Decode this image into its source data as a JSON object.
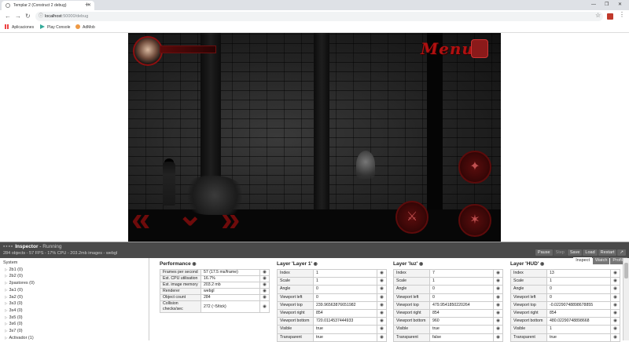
{
  "browser": {
    "tab_title": "Templar 2 (Construct 2 debug)",
    "url_host": "localhost",
    "url_path": ":50000/debug",
    "bookmarks": [
      "Aplicaciones",
      "Play Console",
      "AdMob"
    ]
  },
  "game": {
    "menu_label": "Menu"
  },
  "inspector": {
    "title": "Inspector",
    "status": "Running",
    "stats": "284 objects - 57 FPS - 17% CPU - 203.2mb images - webgl",
    "buttons": [
      "Pause",
      "Step",
      "Save",
      "Load",
      "Restart"
    ],
    "tabs": [
      "Inspect",
      "Watch",
      "Profile"
    ],
    "tree": [
      "System",
      "2b1 (0)",
      "2b2 (0)",
      "2pastores (0)",
      "3a1 (0)",
      "3a2 (0)",
      "3s3 (0)",
      "3s4 (0)",
      "3s5 (0)",
      "3s6 (0)",
      "3s7 (0)",
      "Activador (1)"
    ],
    "performance": {
      "title": "Performance",
      "rows": [
        [
          "Frames per second",
          "57 (17.5 ms/frame)"
        ],
        [
          "Est. CPU utilisation",
          "16.7%"
        ],
        [
          "Est. image memory",
          "203.2 mb"
        ],
        [
          "Renderer",
          "webgl"
        ],
        [
          "Object count",
          "284"
        ],
        [
          "Collision checks/sec",
          "272 (~5/tick)"
        ]
      ]
    },
    "layers": [
      {
        "title": "Layer 'Layer 1'",
        "rows": [
          [
            "Index",
            "1"
          ],
          [
            "Scale",
            "1"
          ],
          [
            "Angle",
            "0"
          ],
          [
            "Viewport left",
            "0"
          ],
          [
            "Viewport top",
            "239.96563876651982"
          ],
          [
            "Viewport right",
            "854"
          ],
          [
            "Viewport bottom",
            "720.0114537444933"
          ],
          [
            "Visible",
            "true"
          ],
          [
            "Transparent",
            "true"
          ]
        ]
      },
      {
        "title": "Layer 'luz'",
        "rows": [
          [
            "Index",
            "7"
          ],
          [
            "Scale",
            "1"
          ],
          [
            "Angle",
            "0"
          ],
          [
            "Viewport left",
            "0"
          ],
          [
            "Viewport top",
            "479.9541850220264"
          ],
          [
            "Viewport right",
            "854"
          ],
          [
            "Viewport bottom",
            "960"
          ],
          [
            "Visible",
            "true"
          ],
          [
            "Transparent",
            "false"
          ]
        ]
      },
      {
        "title": "Layer 'HUD'",
        "rows": [
          [
            "Index",
            "13"
          ],
          [
            "Scale",
            "1"
          ],
          [
            "Angle",
            "0"
          ],
          [
            "Viewport left",
            "0"
          ],
          [
            "Viewport top",
            "-0.02290748898678855"
          ],
          [
            "Viewport right",
            "854"
          ],
          [
            "Viewport bottom",
            "480.02290748898668"
          ],
          [
            "Visible",
            "1"
          ],
          [
            "Transparent",
            "true"
          ]
        ]
      }
    ]
  },
  "icons": {
    "eye": "eye-icon",
    "visibility": "◉"
  }
}
